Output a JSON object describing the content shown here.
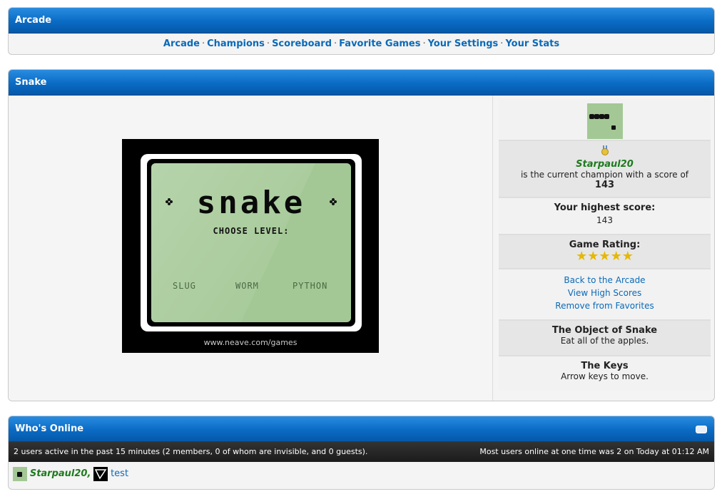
{
  "arcade": {
    "title": "Arcade",
    "nav": [
      "Arcade",
      "Champions",
      "Scoreboard",
      "Favorite Games",
      "Your Settings",
      "Your Stats"
    ],
    "separator": "·"
  },
  "snake": {
    "title": "Snake",
    "game": {
      "logo": "snake",
      "choose": "CHOOSE LEVEL:",
      "levels": [
        "SLUG",
        "WORM",
        "PYTHON"
      ],
      "url": "www.neave.com/games"
    },
    "champion": {
      "name": "Starpaul20",
      "text": "is the current champion with a score of",
      "score": "143"
    },
    "highest": {
      "label": "Your highest score:",
      "value": "143"
    },
    "rating": {
      "label": "Game Rating:",
      "stars": "★★★★★",
      "value": 5
    },
    "links": [
      "Back to the Arcade",
      "View High Scores",
      "Remove from Favorites"
    ],
    "object": {
      "title": "The Object of Snake",
      "text": "Eat all of the apples."
    },
    "keys": {
      "title": "The Keys",
      "text": "Arrow keys to move."
    }
  },
  "online": {
    "title": "Who's Online",
    "active": "2 users active in the past 15 minutes (2 members, 0 of whom are invisible, and 0 guests).",
    "most": "Most users online at one time was 2 on Today at 01:12 AM",
    "users": [
      "Starpaul20",
      "test"
    ],
    "comma": ","
  },
  "colors": {
    "header_blue": "#0a6bc4",
    "link_blue": "#0b6ab8",
    "champion_green": "#1e7a1e",
    "lcd_green": "#a3c895"
  }
}
